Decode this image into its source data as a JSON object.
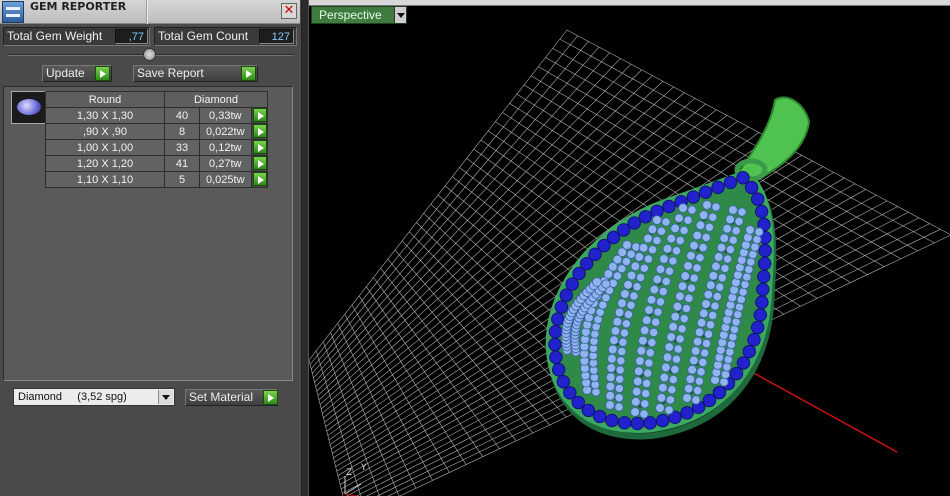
{
  "panel": {
    "title": "GEM REPORTER",
    "close_glyph": "✕",
    "stats": {
      "total_weight_label": "Total Gem Weight",
      "total_weight_value": ",77",
      "total_count_label": "Total Gem Count",
      "total_count_value": "127"
    },
    "update_label": "Update",
    "save_report_label": "Save Report",
    "table": {
      "headers": [
        "Round",
        "Diamond"
      ],
      "rows": [
        {
          "size": "1,30 X 1,30",
          "count": "40",
          "weight": "0,33tw"
        },
        {
          "size": ",90 X ,90",
          "count": "8",
          "weight": "0,022tw"
        },
        {
          "size": "1,00 X 1,00",
          "count": "33",
          "weight": "0,12tw"
        },
        {
          "size": "1,20 X 1,20",
          "count": "41",
          "weight": "0,27tw"
        },
        {
          "size": "1,10 X 1,10",
          "count": "5",
          "weight": "0,025tw"
        }
      ]
    },
    "material_select": {
      "selected": "Diamond     (3,52 spg)"
    },
    "set_material_label": "Set Material"
  },
  "viewport": {
    "view_label": "Perspective",
    "axis_z": "Z",
    "axis_y": "Y",
    "grid_color": "#cfcfcf",
    "axis_x_color": "#c81010",
    "metal_color": "#2f8a4a",
    "bail_color": "#4fc24f",
    "outer_stone_color": "#2222cc",
    "inner_stone_color": "#8fb4f0"
  },
  "icons": [
    "app-icon",
    "close-icon",
    "gem-thumbnail-icon",
    "go-arrow-icon",
    "dropdown-arrow-icon"
  ]
}
